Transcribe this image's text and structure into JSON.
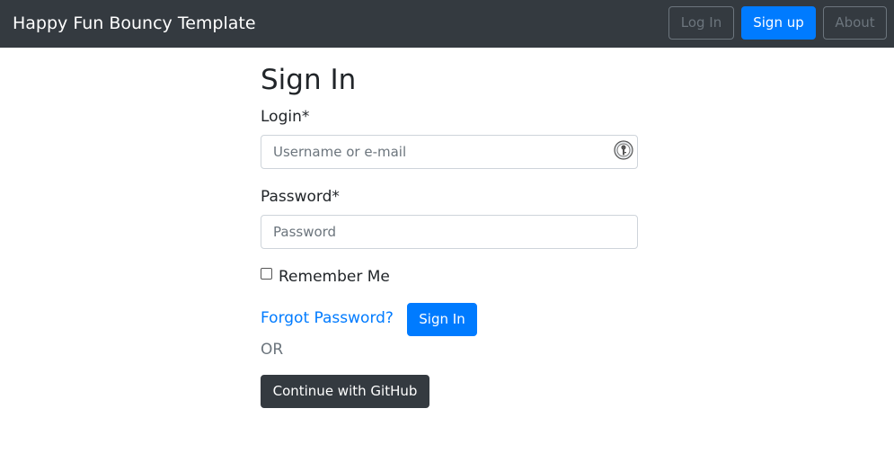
{
  "navbar": {
    "brand": "Happy Fun Bouncy Template",
    "login_label": "Log In",
    "signup_label": "Sign up",
    "about_label": "About"
  },
  "form": {
    "title": "Sign In",
    "login_label": "Login*",
    "login_placeholder": "Username or e-mail",
    "login_value": "",
    "login_field_icon": "password-manager-key-icon",
    "password_label": "Password*",
    "password_placeholder": "Password",
    "password_value": "",
    "remember_label": "Remember Me",
    "remember_checked": false,
    "forgot_label": "Forgot Password?",
    "signin_label": "Sign In",
    "or_text": "OR",
    "github_label": "Continue with GitHub"
  },
  "colors": {
    "navbar_bg": "#343a40",
    "primary": "#007bff",
    "dark_button": "#343a40",
    "muted": "#6c757d"
  }
}
